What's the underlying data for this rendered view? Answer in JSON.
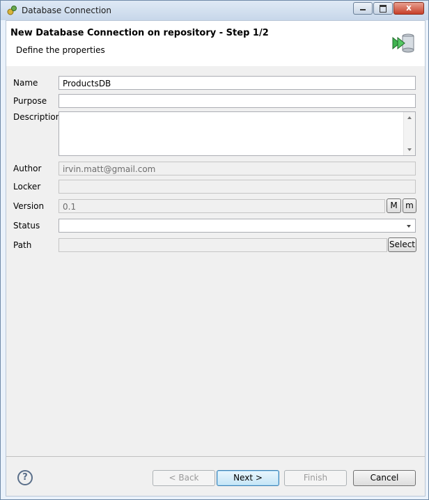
{
  "window": {
    "title": "Database Connection",
    "controls": {
      "minimize_icon": "minimize-icon",
      "maximize_icon": "maximize-icon",
      "close_label": "x"
    }
  },
  "header": {
    "title": "New Database Connection on repository - Step 1/2",
    "subtitle": "Define the properties",
    "icon": "database-wizard-icon"
  },
  "form": {
    "name": {
      "label": "Name",
      "value": "ProductsDB"
    },
    "purpose": {
      "label": "Purpose",
      "value": ""
    },
    "description": {
      "label": "Description",
      "value": ""
    },
    "author": {
      "label": "Author",
      "value": "irvin.matt@gmail.com"
    },
    "locker": {
      "label": "Locker",
      "value": ""
    },
    "version": {
      "label": "Version",
      "value": "0.1",
      "major_button": "M",
      "minor_button": "m"
    },
    "status": {
      "label": "Status",
      "value": ""
    },
    "path": {
      "label": "Path",
      "value": "",
      "select_button": "Select"
    }
  },
  "footer": {
    "help_icon": "help-icon",
    "back_label": "< Back",
    "next_label": "Next >",
    "finish_label": "Finish",
    "cancel_label": "Cancel"
  },
  "colors": {
    "accent": "#3c7fb1",
    "titlebar": "#c7d7ea",
    "dialog_bg": "#f0f0f0"
  }
}
